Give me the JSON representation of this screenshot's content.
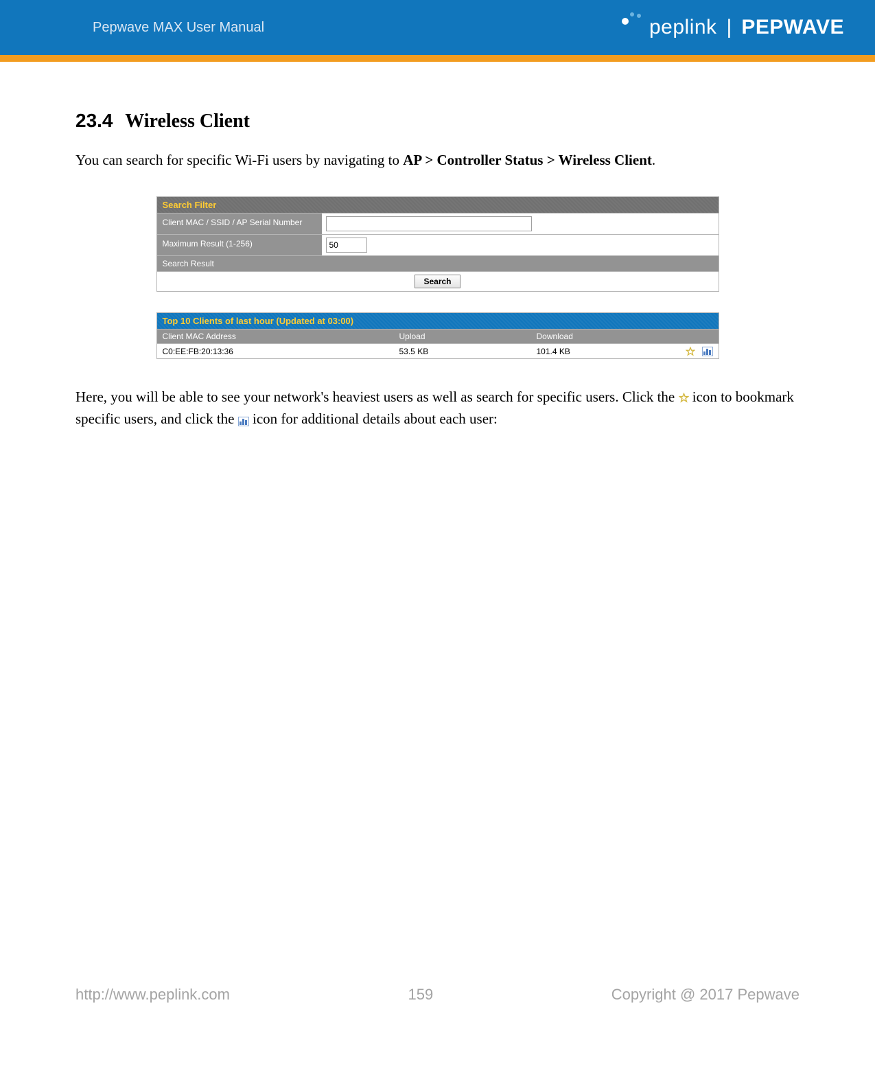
{
  "header": {
    "manual_title": "Pepwave MAX User Manual",
    "brand_left": "peplink",
    "brand_right": "PEPWAVE"
  },
  "section": {
    "number": "23.4",
    "title": "Wireless Client"
  },
  "intro": {
    "prefix": "You can search for specific Wi-Fi users by navigating to ",
    "path": "AP > Controller Status > Wireless Client",
    "suffix": "."
  },
  "search_filter": {
    "panel_title": "Search Filter",
    "row1_label": "Client MAC / SSID / AP Serial Number",
    "row1_value": "",
    "row2_label": "Maximum Result (1-256)",
    "row2_value": "50",
    "result_label": "Search Result",
    "button_label": "Search"
  },
  "top_clients": {
    "panel_title": "Top 10 Clients of last hour (Updated at 03:00)",
    "columns": {
      "mac": "Client MAC Address",
      "upload": "Upload",
      "download": "Download"
    },
    "rows": [
      {
        "mac": "C0:EE:FB:20:13:36",
        "upload": "53.5 KB",
        "download": "101.4 KB"
      }
    ]
  },
  "explain": {
    "part1": "Here, you will be able to see your network's heaviest users as well as search for specific users. Click the ",
    "part2": " icon to bookmark specific users, and click the ",
    "part3": " icon for additional details about each user:"
  },
  "footer": {
    "url": "http://www.peplink.com",
    "page": "159",
    "copyright": "Copyright @ 2017 Pepwave"
  }
}
